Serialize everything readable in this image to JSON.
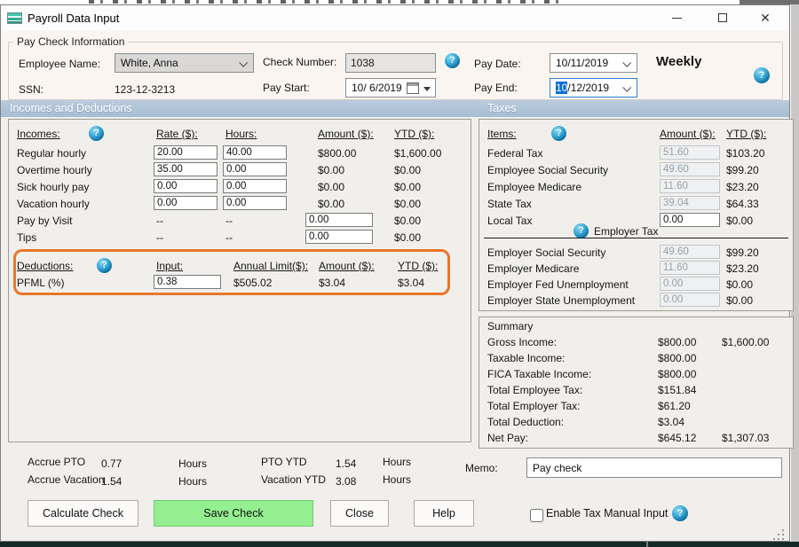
{
  "window": {
    "title": "Payroll Data Input"
  },
  "pay_check_info": {
    "group_label": "Pay Check Information",
    "employee_name_label": "Employee Name:",
    "employee_name_value": "White, Anna",
    "ssn_label": "SSN:",
    "ssn_value": "123-12-3213",
    "check_number_label": "Check Number:",
    "check_number_value": "1038",
    "pay_start_label": "Pay Start:",
    "pay_start_value": "10/ 6/2019",
    "pay_date_label": "Pay Date:",
    "pay_date_value": "10/11/2019",
    "pay_end_label": "Pay End:",
    "pay_end_selected": "10",
    "pay_end_rest": "/12/2019",
    "frequency": "Weekly"
  },
  "sections": {
    "left_header": "Incomes and Deductions",
    "right_header": "Taxes"
  },
  "incomes": {
    "headers": {
      "items": "Incomes:",
      "rate": "Rate ($):",
      "hours": "Hours:",
      "amount": "Amount ($):",
      "ytd": "YTD ($):"
    },
    "rows": [
      {
        "label": "Regular hourly",
        "rate": "20.00",
        "hours": "40.00",
        "amount": "$800.00",
        "ytd": "$1,600.00"
      },
      {
        "label": "Overtime hourly",
        "rate": "35.00",
        "hours": "0.00",
        "amount": "$0.00",
        "ytd": "$0.00"
      },
      {
        "label": "Sick hourly pay",
        "rate": "0.00",
        "hours": "0.00",
        "amount": "$0.00",
        "ytd": "$0.00"
      },
      {
        "label": "Vacation hourly",
        "rate": "0.00",
        "hours": "0.00",
        "amount": "$0.00",
        "ytd": "$0.00"
      },
      {
        "label": "Pay by Visit",
        "rate": "--",
        "hours": "--",
        "amount": "0.00",
        "ytd": "$0.00"
      },
      {
        "label": "Tips",
        "rate": "--",
        "hours": "--",
        "amount": "0.00",
        "ytd": "$0.00"
      }
    ]
  },
  "deductions": {
    "headers": {
      "items": "Deductions:",
      "input": "Input:",
      "annual_limit": "Annual Limit($):",
      "amount": "Amount ($):",
      "ytd": "YTD ($):"
    },
    "rows": [
      {
        "label": "PFML  (%)",
        "input": "0.38",
        "annual_limit": "$505.02",
        "amount": "$3.04",
        "ytd": "$3.04"
      }
    ]
  },
  "taxes": {
    "headers": {
      "items": "Items:",
      "amount": "Amount ($):",
      "ytd": "YTD ($):"
    },
    "employee_rows": [
      {
        "label": "Federal Tax",
        "amount": "51.60",
        "ytd": "$103.20"
      },
      {
        "label": "Employee Social Security",
        "amount": "49.60",
        "ytd": "$99.20"
      },
      {
        "label": "Employee Medicare",
        "amount": "11.60",
        "ytd": "$23.20"
      },
      {
        "label": "State Tax",
        "amount": "39.04",
        "ytd": "$64.33"
      },
      {
        "label": "Local Tax",
        "amount": "0.00",
        "ytd": "$0.00"
      }
    ],
    "employer_divider_label": "Employer Tax",
    "employer_rows": [
      {
        "label": "Employer Social Security",
        "amount": "49.60",
        "ytd": "$99.20"
      },
      {
        "label": "Employer Medicare",
        "amount": "11.60",
        "ytd": "$23.20"
      },
      {
        "label": "Employer Fed Unemployment",
        "amount": "0.00",
        "ytd": "$0.00"
      },
      {
        "label": "Employer State Unemployment",
        "amount": "0.00",
        "ytd": "$0.00"
      }
    ]
  },
  "summary": {
    "title": "Summary",
    "rows": [
      {
        "label": "Gross Income:",
        "value": "$800.00",
        "ytd": "$1,600.00"
      },
      {
        "label": "Taxable Income:",
        "value": "$800.00",
        "ytd": ""
      },
      {
        "label": "FICA Taxable Income:",
        "value": "$800.00",
        "ytd": ""
      },
      {
        "label": "Total Employee Tax:",
        "value": "$151.84",
        "ytd": ""
      },
      {
        "label": "Total Employer Tax:",
        "value": "$61.20",
        "ytd": ""
      },
      {
        "label": "Total Deduction:",
        "value": "$3.04",
        "ytd": ""
      },
      {
        "label": "Net Pay:",
        "value": "$645.12",
        "ytd": "$1,307.03"
      }
    ]
  },
  "accruals": {
    "rows": [
      {
        "label": "Accrue PTO",
        "value": "0.77",
        "unit": "Hours",
        "ytd_label": "PTO YTD",
        "ytd_value": "1.54",
        "ytd_unit": "Hours"
      },
      {
        "label": "Accrue Vacation",
        "value": "1.54",
        "unit": "Hours",
        "ytd_label": "Vacation YTD",
        "ytd_value": "3.08",
        "ytd_unit": "Hours"
      }
    ]
  },
  "memo": {
    "label": "Memo:",
    "value": "Pay check"
  },
  "buttons": {
    "calculate": "Calculate Check",
    "save": "Save Check",
    "close": "Close",
    "help": "Help"
  },
  "tax_manual_checkbox": {
    "label": "Enable Tax Manual Input",
    "checked": false
  },
  "colors": {
    "highlight_orange": "#E8772B",
    "section_bar_blue": "#AFC3D6",
    "save_button_green": "#93EF8F",
    "help_icon_blue": "#0D6F9F"
  }
}
